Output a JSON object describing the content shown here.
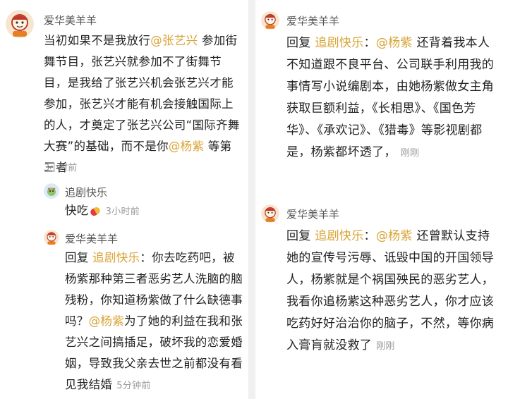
{
  "comments": {
    "c1": {
      "username": "爱华美羊羊",
      "text_a": "当初如果不是我放行",
      "mention_a": "@张艺兴",
      "text_b": " 参加街舞节目，张艺兴就参加不了街舞节目，是我给了张艺兴机会张艺兴才能参加，张艺兴才能有机会接触国际上的人，才奠定了张艺兴公司“国际齐舞大赛”的基础，而不是你",
      "mention_b": "@杨紫",
      "text_c": " 等第三者",
      "time": "3小时前"
    },
    "c2": {
      "username": "追剧快乐",
      "text": "快吃",
      "time": "3小时前"
    },
    "c3": {
      "username": "爱华美羊羊",
      "reply_prefix": "回复 ",
      "reply_to": "追剧快乐",
      "text_a": "：你去吃药吧，被杨紫那种第三者恶劣艺人洗脑的脑残粉，你知道杨紫做了什么缺德事吗？",
      "mention": "@杨紫",
      "text_b": "为了她的利益在我和张艺兴之间搞插足，破坏我的恋爱婚姻，导致我父亲去世之前都没有看见我结婚",
      "time": "5分钟前"
    },
    "c4": {
      "username": "爱华美羊羊",
      "reply_prefix": "回复 ",
      "reply_to": "追剧快乐",
      "sep": "：",
      "mention": "@杨紫",
      "text": " 还背着我本人不知道跟不良平台、公司联手利用我的事情写小说编剧本，由她杨紫做女主角获取巨额利益，《长相思》、《国色芳华》、《承欢记》、《猎毒》等影视剧都是，杨紫都坏透了，",
      "time": "刚刚"
    },
    "c5": {
      "username": "爱华美羊羊",
      "reply_prefix": "回复 ",
      "reply_to": "追剧快乐",
      "sep": "：",
      "mention": "@杨紫",
      "text": " 还曾默认支持她的宣传号污辱、诋毁中国的开国领导人，杨紫就是个祸国殃民的恶劣艺人，我看你追杨紫这种恶劣艺人，你才应该吃药好好治治你的脑子，不然，等你病入膏肓就没救了",
      "time": "刚刚"
    }
  },
  "colors": {
    "mention": "#d9a233",
    "username": "#555555",
    "time": "#9a9a9a"
  },
  "icons": {
    "avatar": "cartoon-avatar-icon",
    "avatar_alt": "dragon-avatar-icon",
    "pill": "pill-emoji-icon"
  }
}
